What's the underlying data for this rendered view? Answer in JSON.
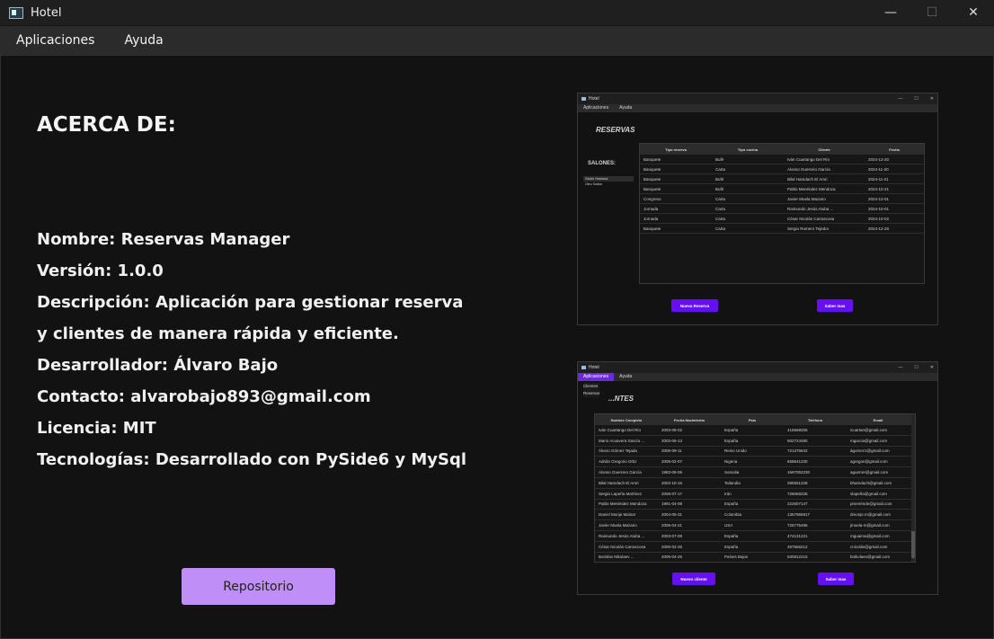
{
  "window": {
    "title": "Hotel",
    "controls": {
      "minimize": "—",
      "maximize": "☐",
      "close": "✕"
    }
  },
  "menu": {
    "items": [
      "Aplicaciones",
      "Ayuda"
    ]
  },
  "about": {
    "heading": "ACERCA DE:",
    "lines": [
      "Nombre: Reservas Manager",
      "Versión: 1.0.0",
      "Descripción: Aplicación para gestionar reserva",
      "y clientes de manera rápida y eficiente.",
      "Desarrollador: Álvaro Bajo",
      "Contacto: alvarobajo893@gmail.com",
      "Licencia: MIT",
      "Tecnologías: Desarrollado con PySide6 y MySql"
    ],
    "repo_button": "Repositorio"
  },
  "preview_reservas": {
    "title": "Hotel",
    "menu": [
      "Aplicaciones",
      "Ayuda"
    ],
    "heading": "RESERVAS",
    "salones_label": "SALONES:",
    "salones": [
      "Salón Habana",
      "Otro Salón"
    ],
    "columns": [
      "Tipo reserva",
      "Tipo cocina",
      "Cliente",
      "Fecha"
    ],
    "rows": [
      [
        "Banquete",
        "Bufé",
        "Iván Cuartango Del Río",
        "2024-12-20"
      ],
      [
        "Banquete",
        "Carta",
        "Alonso Guerrero García",
        "2024-11-20"
      ],
      [
        "Banquete",
        "Bufé",
        "Bilal Hamdach El Amri",
        "2024-11-21"
      ],
      [
        "Banquete",
        "Bufé",
        "Pablo Menéndez Mendoza",
        "2024-10-21"
      ],
      [
        "Congreso",
        "Carta",
        "Javier Muela Mazario",
        "2024-12-01"
      ],
      [
        "Jornada",
        "Carta",
        "Raimundo Jesús Atuba ...",
        "2024-10-01"
      ],
      [
        "Jornada",
        "Carta",
        "César Nicolás Carrascosa",
        "2024-10-02"
      ],
      [
        "Banquete",
        "Carta",
        "Sergio Romero Tejedor",
        "2024-12-25"
      ]
    ],
    "btn_new": "Nueva Reserva",
    "btn_more": "Saber mas"
  },
  "preview_clientes": {
    "title": "Hotel",
    "menu": [
      "Aplicaciones",
      "Ayuda"
    ],
    "dropdown": [
      "Clientes",
      "Reservar"
    ],
    "heading": "...NTES",
    "columns": [
      "Nombre Completo",
      "Fecha Nacimiento",
      "País",
      "Teléfono",
      "Email"
    ],
    "rows": [
      [
        "Iván Cuartango Del Río",
        "2003-08-02",
        "España",
        "416568265",
        "icuartan@gmail.com"
      ],
      [
        "Mario Acuavera García ...",
        "2003-06-13",
        "España",
        "602724480",
        "mgarcia@gmail.com"
      ],
      [
        "Álvaro Gómez Tejada",
        "2006-09-11",
        "Reino Unido",
        "721376842",
        "ágomez1@gmail.com"
      ],
      [
        "Adrián Gregorio Ortiz",
        "2005-02-07",
        "Nigeria",
        "659641230",
        "agregori@gmail.com"
      ],
      [
        "Alonso Guerrero García",
        "1983-09-06",
        "Somalia",
        "1697052230",
        "aguerrer@gmail.com"
      ],
      [
        "Bilal Hamdach El Amri",
        "2002-10-16",
        "Tailandia",
        "395551228",
        "bhamdach@gmail.com"
      ],
      [
        "Sergio Lapeña Martínez",
        "2006-07-17",
        "Irán",
        "728068228",
        "slapeña@gmail.com"
      ],
      [
        "Pablo Menéndez Mendoza",
        "1991-04-08",
        "España",
        "222607147",
        "pmenénde@gmail.com"
      ],
      [
        "Daniel Monje Mainar",
        "2004-05-31",
        "Colombia",
        "1357965817",
        "dmonje.m@gmail.com"
      ],
      [
        "Javier Muela Mazario",
        "2006-04-21",
        "USA",
        "726775496",
        "jmuela-m@gmail.com"
      ],
      [
        "Raimundo Jesús Atuba ...",
        "2003-07-08",
        "España",
        "474131221",
        "mguaima@gmail.com"
      ],
      [
        "César Nicolás Carrascosa",
        "2000-02-26",
        "España",
        "497556212",
        "cnicolás@gmail.com"
      ],
      [
        "Borislav Nikolaev ...",
        "2005-04-25",
        "Países Bajos",
        "630812215",
        "bnikolaev@gmail.com"
      ],
      [
        "Sergio Romero Tejedor",
        "2004-01-03",
        "México",
        "1629071747",
        "sromero@gmail.com"
      ]
    ],
    "btn_new": "Nuevo cliente",
    "btn_more": "Saber mas"
  }
}
